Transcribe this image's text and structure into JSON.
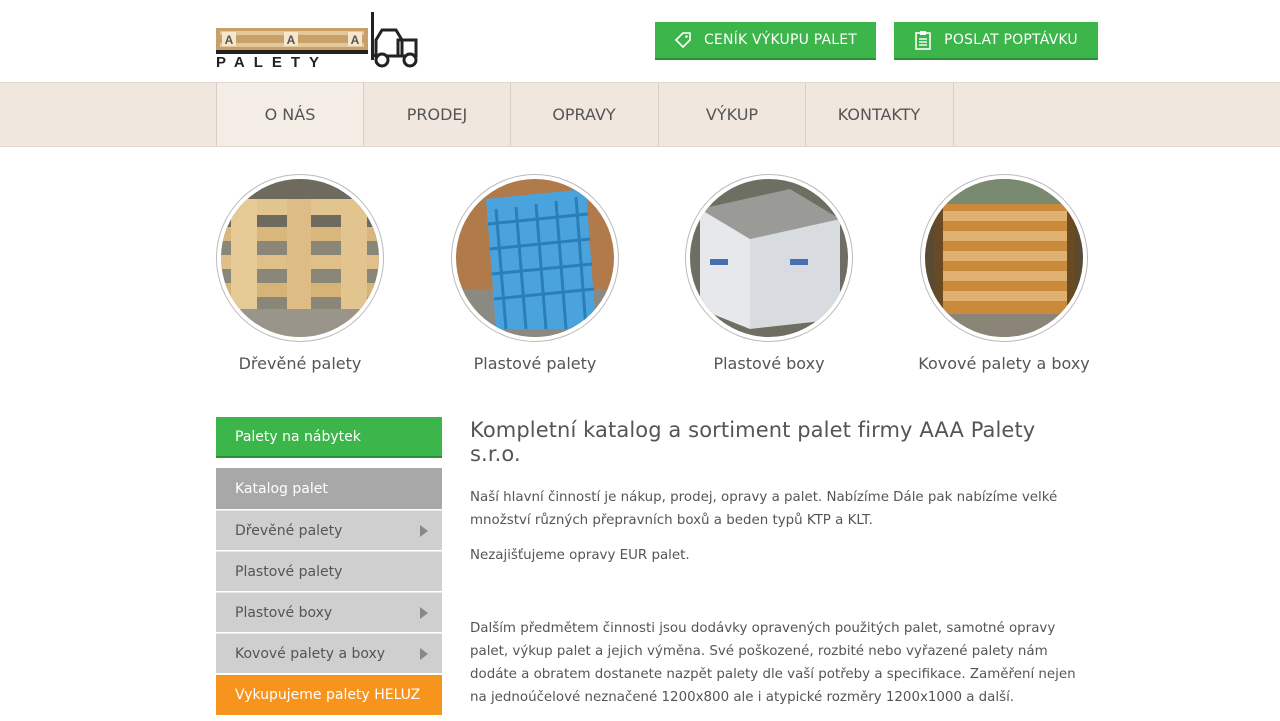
{
  "header": {
    "logo_text": "PALETY",
    "logo_letters": [
      "A",
      "A",
      "A"
    ],
    "btn_price": "CENÍK VÝKUPU PALET",
    "btn_inquiry": "POSLAT POPTÁVKU"
  },
  "nav": {
    "items": [
      {
        "label": "O NÁS"
      },
      {
        "label": "PRODEJ"
      },
      {
        "label": "OPRAVY"
      },
      {
        "label": "VÝKUP"
      },
      {
        "label": "KONTAKTY"
      }
    ]
  },
  "categories": [
    {
      "label": "Dřevěné palety"
    },
    {
      "label": "Plastové palety"
    },
    {
      "label": "Plastové boxy"
    },
    {
      "label": "Kovové palety a boxy"
    }
  ],
  "sidebar": {
    "promo": "Palety na nábytek",
    "heading": "Katalog palet",
    "items": [
      {
        "label": "Dřevěné palety"
      },
      {
        "label": "Plastové palety"
      },
      {
        "label": "Plastové boxy"
      },
      {
        "label": "Kovové palety a boxy"
      }
    ],
    "orange": "Vykupujeme palety HELUZ"
  },
  "content": {
    "title": "Kompletní katalog a sortiment palet firmy AAA Palety s.r.o.",
    "p1": "Naší hlavní činností je nákup, prodej, opravy a palet. Nabízíme Dále pak nabízíme velké množství různých přepravních boxů a beden typů KTP a KLT.",
    "p2": "Nezajišťujeme opravy EUR palet.",
    "p3": "Dalším předmětem činnosti jsou dodávky opravených použitých palet, samotné opravy palet, výkup palet a jejich výměna. Své poškozené, rozbité nebo vyřazené palety nám dodáte a obratem dostanete nazpět palety dle vaší potřeby  a specifikace. Zaměření  nejen na jednoúčelové neznačené 1200x800 ale i  atypické rozměry 1200x1000 a další."
  },
  "colors": {
    "green": "#3cb54a",
    "orange": "#f7941d",
    "nav_bg": "#f0e8df",
    "sidebar_grey": "#cfcfcf"
  }
}
